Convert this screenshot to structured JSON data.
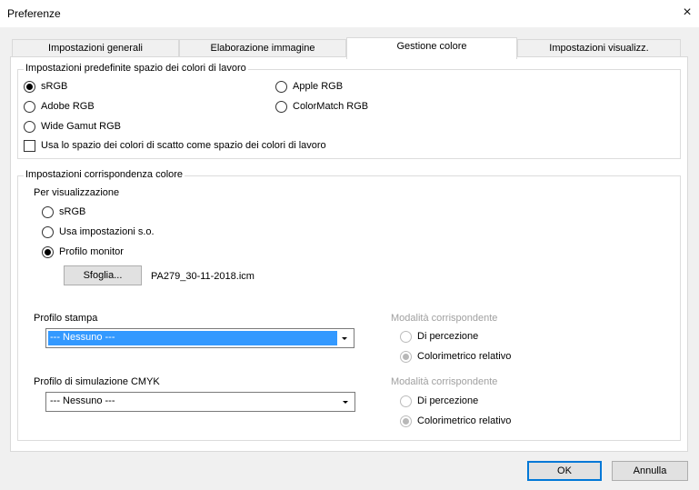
{
  "window": {
    "title": "Preferenze",
    "close_glyph": "×"
  },
  "tabs": [
    {
      "label": "Impostazioni generali",
      "active": false
    },
    {
      "label": "Elaborazione immagine",
      "active": false
    },
    {
      "label": "Gestione colore",
      "active": true
    },
    {
      "label": "Impostazioni visualizz.",
      "active": false
    }
  ],
  "workspace": {
    "legend": "Impostazioni predefinite spazio dei colori di lavoro",
    "options": [
      {
        "label": "sRGB",
        "checked": true
      },
      {
        "label": "Apple RGB",
        "checked": false
      },
      {
        "label": "Adobe RGB",
        "checked": false
      },
      {
        "label": "ColorMatch RGB",
        "checked": false
      },
      {
        "label": "Wide Gamut RGB",
        "checked": false
      }
    ],
    "use_shooting_space_label": "Usa lo spazio dei colori di scatto come spazio dei colori di lavoro",
    "use_shooting_space_checked": false
  },
  "matching": {
    "legend": "Impostazioni corrispondenza colore",
    "display_label": "Per visualizzazione",
    "display_options": [
      {
        "label": "sRGB",
        "checked": false
      },
      {
        "label": "Usa impostazioni s.o.",
        "checked": false
      },
      {
        "label": "Profilo monitor",
        "checked": true
      }
    ],
    "browse_label": "Sfoglia...",
    "monitor_profile_file": "PA279_30-11-2018.icm",
    "print_profile": {
      "label": "Profilo stampa",
      "value": "---   Nessuno   ---",
      "mode_label": "Modalità corrispondente",
      "modes": [
        {
          "label": "Di percezione",
          "checked": false
        },
        {
          "label": "Colorimetrico relativo",
          "checked": true
        }
      ]
    },
    "cmyk_profile": {
      "label": "Profilo di simulazione CMYK",
      "value": "---   Nessuno   ---",
      "mode_label": "Modalità corrispondente",
      "modes": [
        {
          "label": "Di percezione",
          "checked": false
        },
        {
          "label": "Colorimetrico relativo",
          "checked": true
        }
      ]
    }
  },
  "footer": {
    "ok_label": "OK",
    "cancel_label": "Annulla"
  },
  "colors": {
    "accent": "#0078d7",
    "selection": "#3399ff",
    "disabled_text": "#a0a0a0"
  }
}
